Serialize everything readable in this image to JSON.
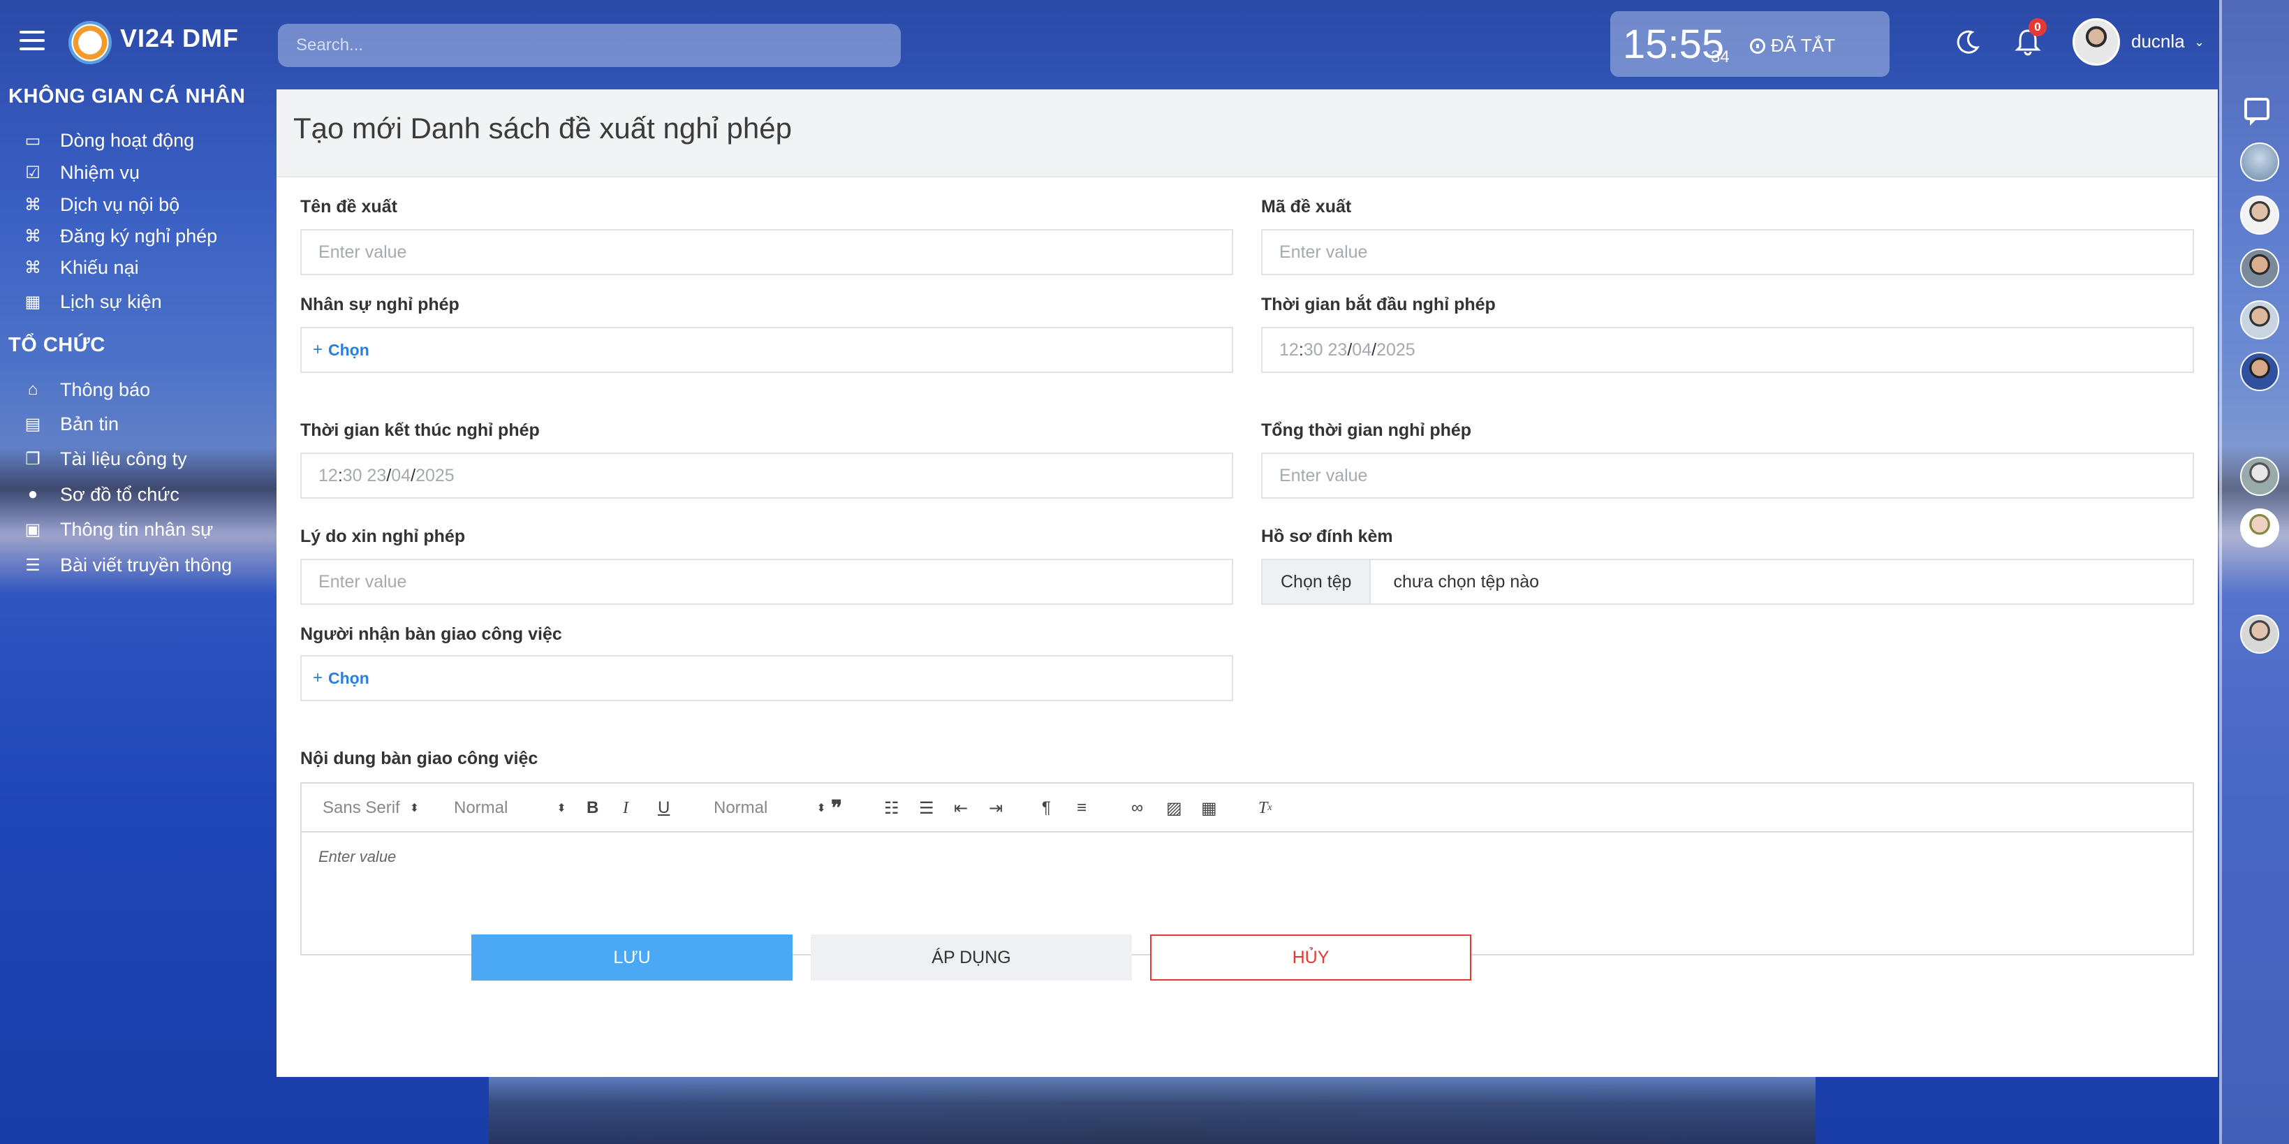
{
  "app": {
    "brand": "VI24 DMF"
  },
  "search": {
    "placeholder": "Search..."
  },
  "clock": {
    "time": "15:55",
    "seconds": "34",
    "status": "ĐÃ TẮT"
  },
  "notifications": {
    "count": "0"
  },
  "user": {
    "name": "ducnla"
  },
  "sidebar": {
    "personal_title": "KHÔNG GIAN CÁ NHÂN",
    "personal_items": [
      {
        "label": "Dòng hoạt động",
        "icon": "inbox-icon"
      },
      {
        "label": "Nhiệm vụ",
        "icon": "checkbox-icon"
      },
      {
        "label": "Dịch vụ nội bộ",
        "icon": "command-icon"
      },
      {
        "label": "Đăng ký nghỉ phép",
        "icon": "command-icon"
      },
      {
        "label": "Khiếu nại",
        "icon": "command-icon"
      },
      {
        "label": "Lịch sự kiện",
        "icon": "calendar-icon"
      }
    ],
    "org_title": "TỔ CHỨC",
    "org_items": [
      {
        "label": "Thông báo",
        "icon": "home-icon"
      },
      {
        "label": "Bản tin",
        "icon": "newspaper-icon"
      },
      {
        "label": "Tài liệu công ty",
        "icon": "documents-icon"
      },
      {
        "label": "Sơ đồ tổ chức",
        "icon": "org-chart-icon"
      },
      {
        "label": "Thông tin nhân sự",
        "icon": "id-card-icon"
      },
      {
        "label": "Bài viết truyền thông",
        "icon": "list-icon"
      }
    ]
  },
  "form": {
    "title": "Tạo mới Danh sách đề xuất nghỉ phép",
    "placeholder": "Enter value",
    "pick_label": "Chọn",
    "fields": {
      "proposal_name": "Tên đề xuất",
      "proposal_code": "Mã đề xuất",
      "employee": "Nhân sự nghỉ phép",
      "start_time": "Thời gian bắt đầu nghỉ phép",
      "end_time": "Thời gian kết thúc nghỉ phép",
      "total_time": "Tổng thời gian nghỉ phép",
      "reason": "Lý do xin nghỉ phép",
      "attachment": "Hồ sơ đính kèm",
      "handover_receiver": "Người nhận bàn giao công việc",
      "handover_content": "Nội dung bàn giao công việc"
    },
    "datetime": {
      "hour": "12",
      "minute": "30",
      "day": "23",
      "month": "04",
      "year": "2025"
    },
    "file": {
      "button": "Chọn tệp",
      "status": "chưa chọn tệp nào"
    },
    "editor": {
      "font": "Sans Serif",
      "size": "Normal",
      "heading": "Normal",
      "placeholder": "Enter value"
    }
  },
  "actions": {
    "save": "LƯU",
    "apply": "ÁP DỤNG",
    "cancel": "HỦY"
  },
  "colors": {
    "primary": "#4aa8f5",
    "danger": "#e53935",
    "link": "#2a7fd9"
  }
}
